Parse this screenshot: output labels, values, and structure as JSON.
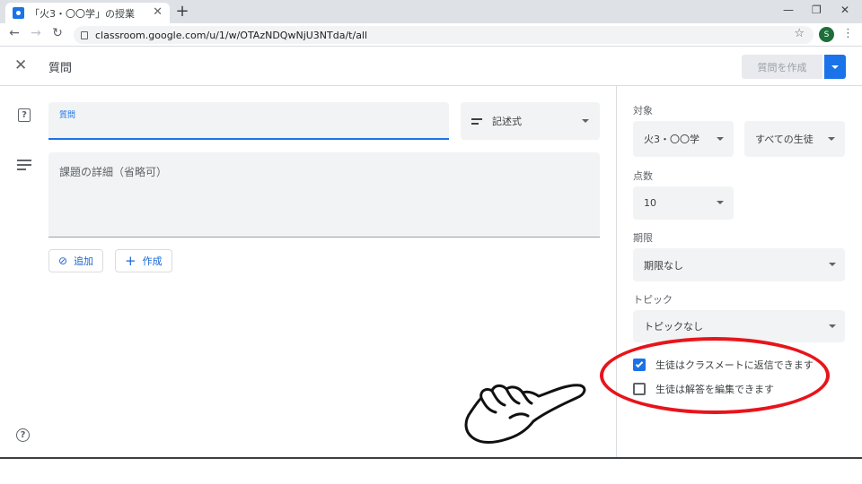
{
  "browser": {
    "tab_title": "「火3・〇〇学」の授業",
    "url": "classroom.google.com/u/1/w/OTAzNDQwNjU3NTda/t/all",
    "profile_initial": "S"
  },
  "header": {
    "title": "質問",
    "create_button": "質問を作成"
  },
  "form": {
    "question_label": "質問",
    "question_type": "記述式",
    "details_placeholder": "課題の詳細（省略可）",
    "add_button": "追加",
    "create_button": "作成"
  },
  "panel": {
    "target_label": "対象",
    "class_value": "火3・〇〇学",
    "students_value": "すべての生徒",
    "points_label": "点数",
    "points_value": "10",
    "due_label": "期限",
    "due_value": "期限なし",
    "topic_label": "トピック",
    "topic_value": "トピックなし",
    "options": [
      {
        "label": "生徒はクラスメートに返信できます",
        "checked": true
      },
      {
        "label": "生徒は解答を編集できます",
        "checked": false
      }
    ]
  },
  "colors": {
    "accent": "#1a73e8",
    "highlight": "#e8141b"
  }
}
